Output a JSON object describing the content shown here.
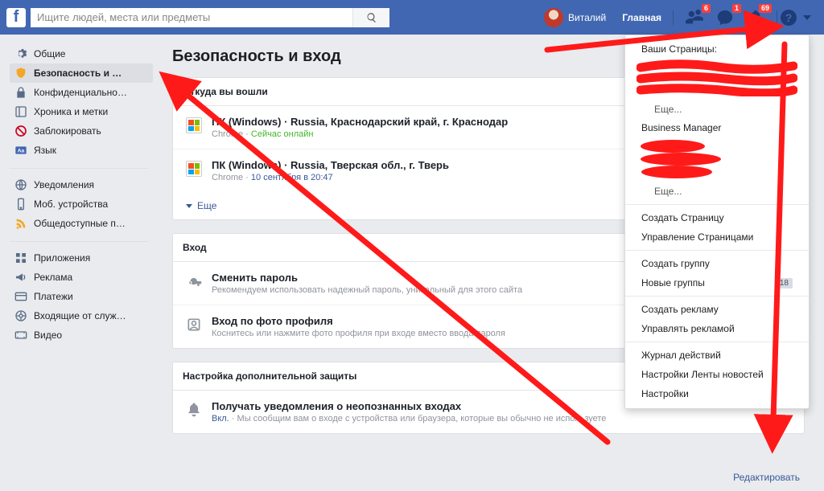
{
  "search": {
    "placeholder": "Ищите людей, места или предметы"
  },
  "topbar": {
    "user_name": "Виталий",
    "home": "Главная",
    "badge_friends": "6",
    "badge_messages": "1",
    "badge_notifications": "69"
  },
  "sidebar": {
    "g1": [
      {
        "icon": "gear",
        "label": "Общие"
      },
      {
        "icon": "shield",
        "label": "Безопасность и …"
      },
      {
        "icon": "lock",
        "label": "Конфиденциально…"
      },
      {
        "icon": "timeline",
        "label": "Хроника и метки"
      },
      {
        "icon": "block",
        "label": "Заблокировать"
      },
      {
        "icon": "lang",
        "label": "Язык"
      }
    ],
    "g2": [
      {
        "icon": "globe",
        "label": "Уведомления"
      },
      {
        "icon": "mobile",
        "label": "Моб. устройства"
      },
      {
        "icon": "rss",
        "label": "Общедоступные п…"
      }
    ],
    "g3": [
      {
        "icon": "apps",
        "label": "Приложения"
      },
      {
        "icon": "ads",
        "label": "Реклама"
      },
      {
        "icon": "card",
        "label": "Платежи"
      },
      {
        "icon": "support",
        "label": "Входящие от служ…"
      },
      {
        "icon": "video",
        "label": "Видео"
      }
    ]
  },
  "page_title": "Безопасность и вход",
  "sessions": {
    "header": "Откуда вы вошли",
    "rows": [
      {
        "title": "ПК (Windows) · Russia, Краснодарский край, г. Краснодар",
        "sub_browser": "Chrome",
        "sub_status": "Сейчас онлайн",
        "online": true
      },
      {
        "title": "ПК (Windows) · Russia, Тверская обл., г. Тверь",
        "sub_browser": "Chrome",
        "sub_status": "10 сентября в 20:47",
        "online": false
      }
    ],
    "more": "Еще"
  },
  "login": {
    "header": "Вход",
    "rows": [
      {
        "title": "Сменить пароль",
        "sub": "Рекомендуем использовать надежный пароль, уникальный для этого сайта"
      },
      {
        "title": "Вход по фото профиля",
        "sub": "Коснитесь или нажмите фото профиля при входе вместо ввода пароля"
      }
    ]
  },
  "extra": {
    "header": "Настройка дополнительной защиты",
    "row_title": "Получать уведомления о неопознанных входах",
    "row_state": "Вкл.",
    "row_sub_tail": "Мы сообщим вам о входе с устройства или браузера, которые вы обычно не используете"
  },
  "edit_label": "Редактировать",
  "dropdown": {
    "pages_label": "Ваши Страницы:",
    "more": "Еще...",
    "bm_label": "Business Manager",
    "items_a": [
      "Создать Страницу",
      "Управление Страницами"
    ],
    "items_b": [
      "Создать группу"
    ],
    "new_groups": "Новые группы",
    "new_groups_badge": "18",
    "items_c": [
      "Создать рекламу",
      "Управлять рекламой"
    ],
    "items_d": [
      "Журнал действий",
      "Настройки Ленты новостей",
      "Настройки"
    ]
  }
}
